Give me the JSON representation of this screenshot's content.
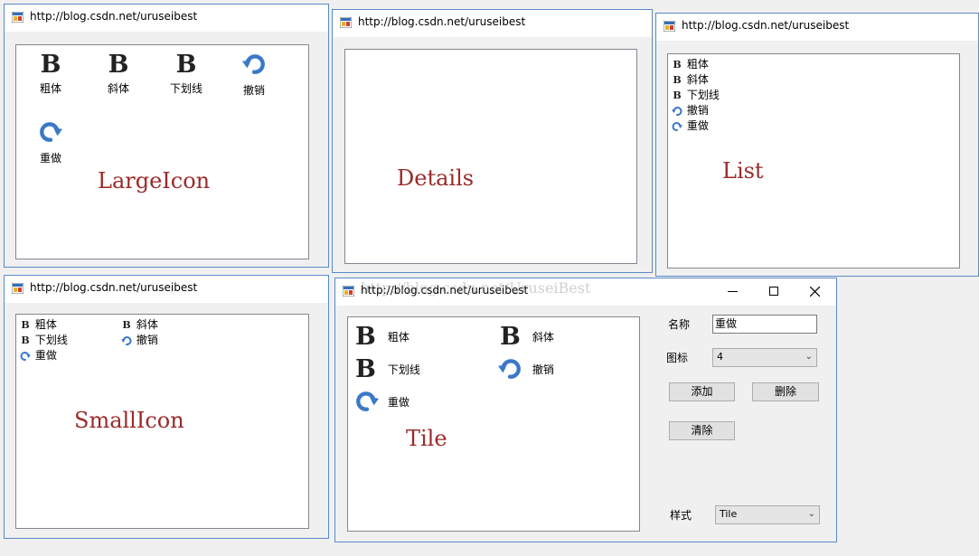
{
  "window_title": "http://blog.csdn.net/uruseibest",
  "items": [
    {
      "label": "粗体",
      "icon": "bold-icon"
    },
    {
      "label": "斜体",
      "icon": "bold-icon"
    },
    {
      "label": "下划线",
      "icon": "bold-icon"
    },
    {
      "label": "撤销",
      "icon": "undo-icon"
    },
    {
      "label": "重做",
      "icon": "redo-icon"
    }
  ],
  "captions": {
    "large_icon": "LargeIcon",
    "details": "Details",
    "list": "List",
    "small_icon": "SmallIcon",
    "tile": "Tile"
  },
  "watermark": "http://blog.csdn.net/UruseiBest",
  "controls": {
    "name_label": "名称",
    "name_value": "重做",
    "icon_label": "图标",
    "icon_value": "4",
    "add_button": "添加",
    "delete_button": "删除",
    "clear_button": "清除",
    "style_label": "样式",
    "style_value": "Tile"
  },
  "colors": {
    "caption": "#9b2a2a",
    "border": "#5b8ac6",
    "icon_blue": "#3a78c8"
  }
}
